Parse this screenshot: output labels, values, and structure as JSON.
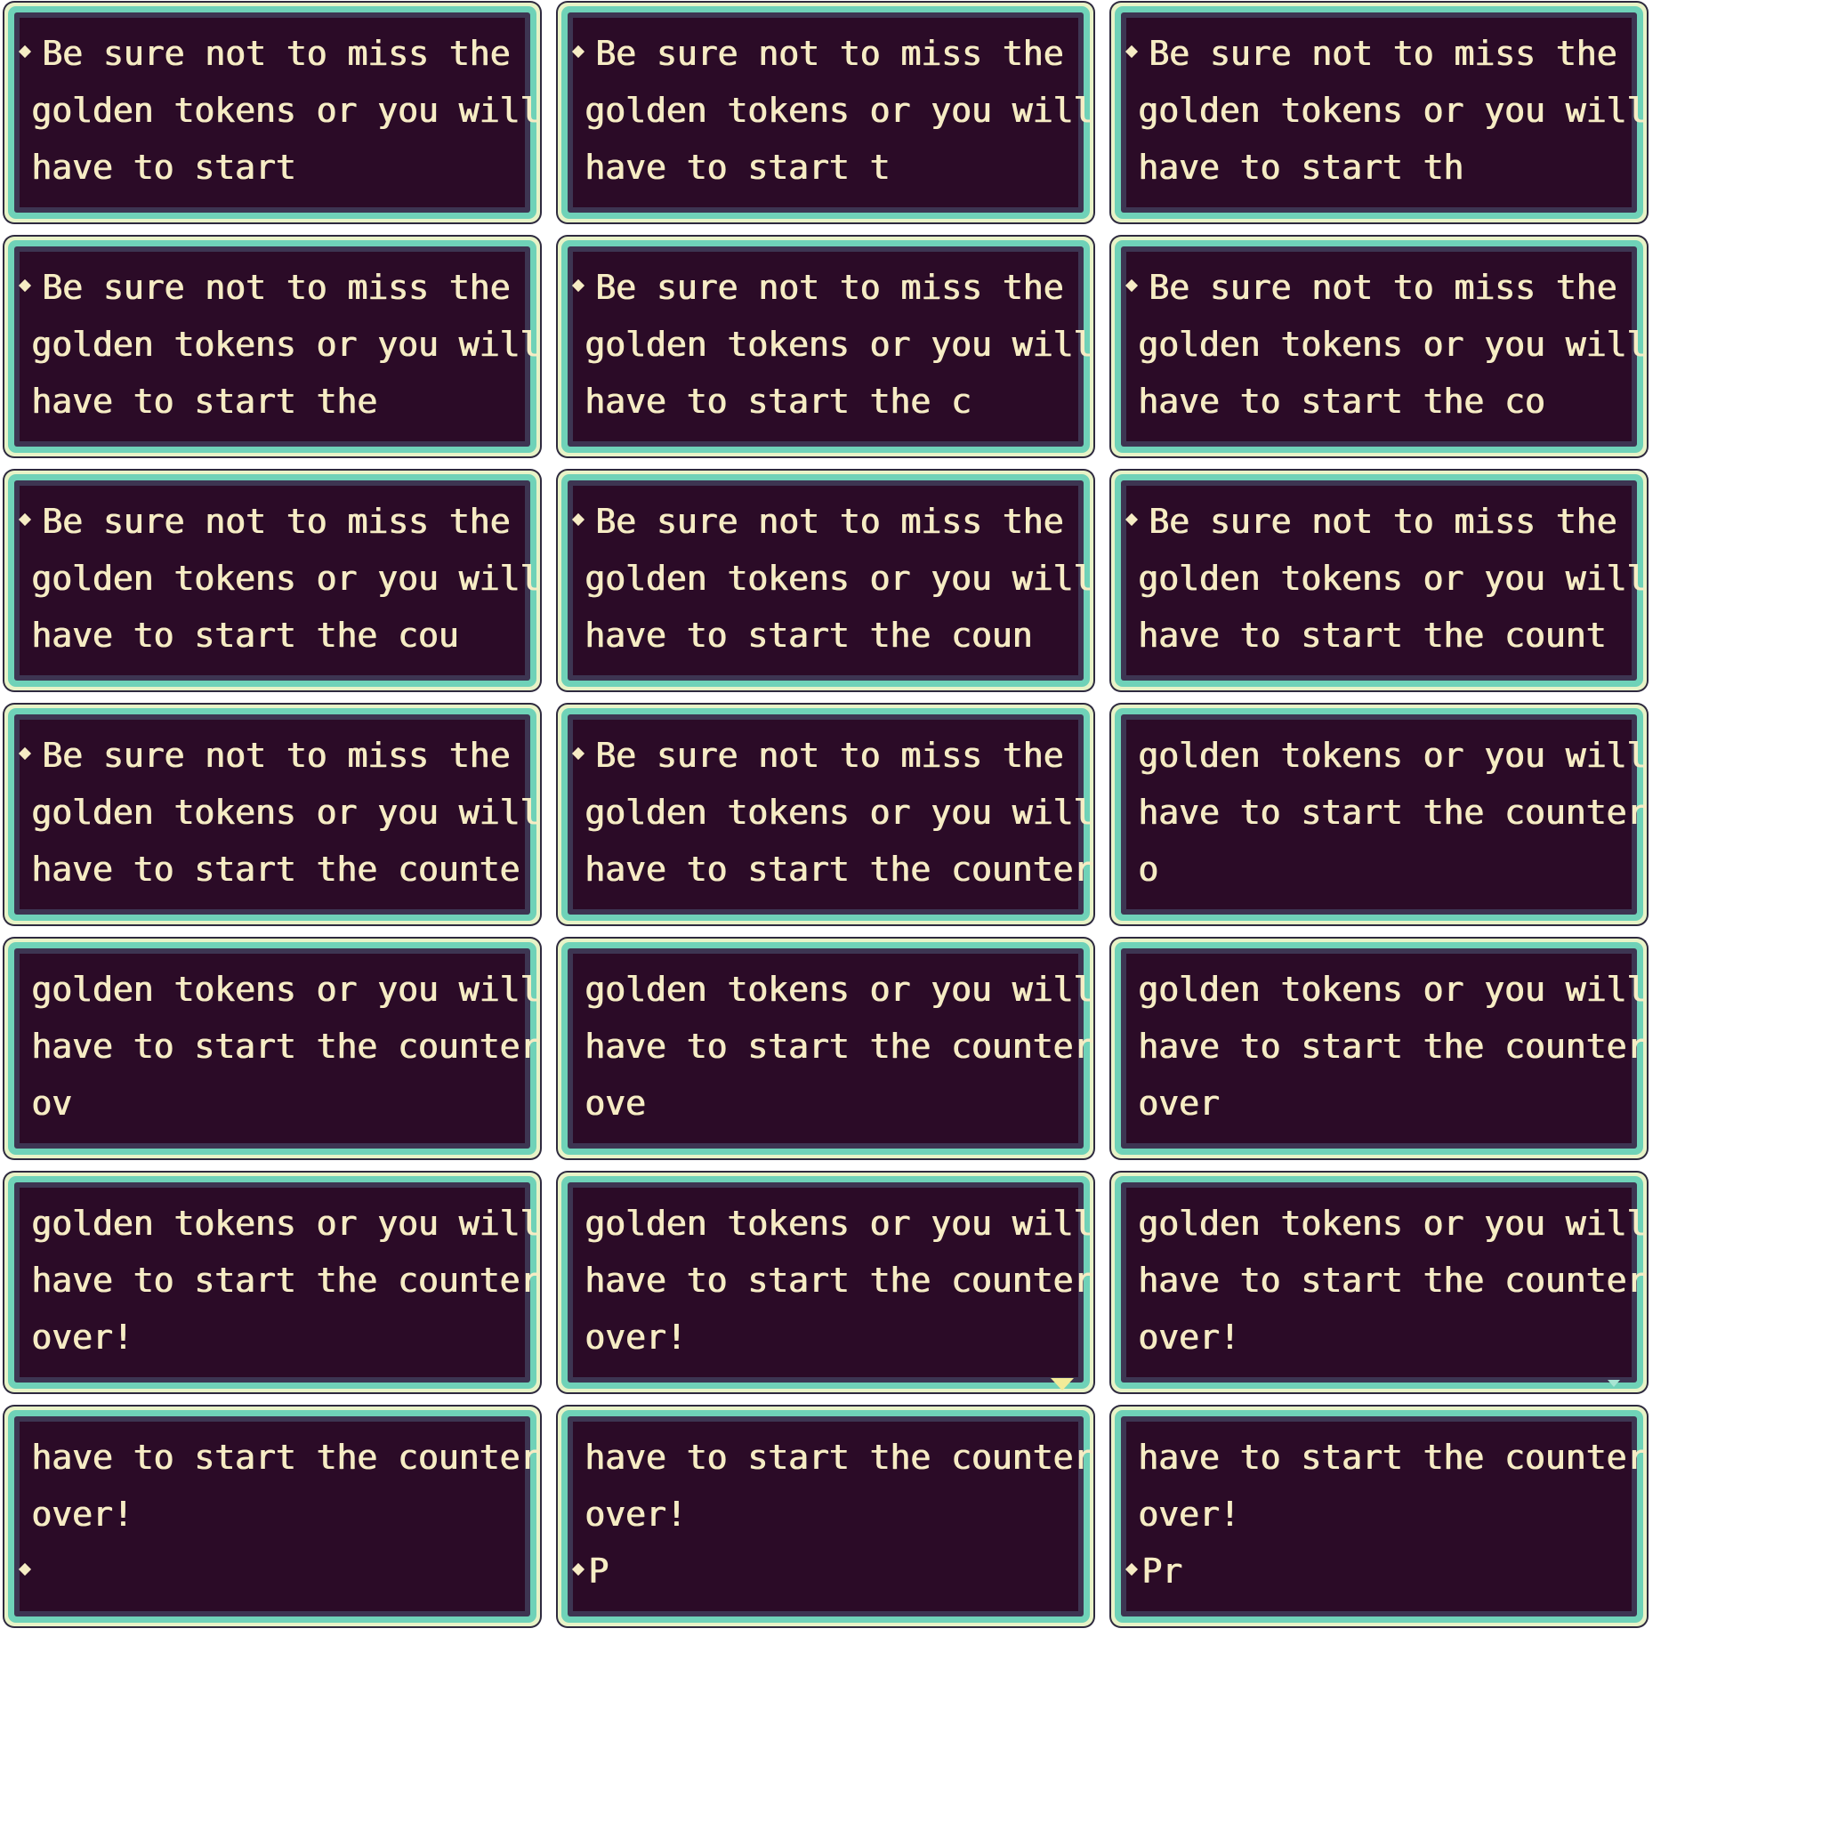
{
  "sheet": {
    "frames": [
      {
        "lines": [
          "Be sure not to miss the",
          "golden tokens or you will",
          "have to start"
        ],
        "bullet_line": 0
      },
      {
        "lines": [
          "Be sure not to miss the",
          "golden tokens or you will",
          "have to start t"
        ],
        "bullet_line": 0
      },
      {
        "lines": [
          "Be sure not to miss the",
          "golden tokens or you will",
          "have to start th"
        ],
        "bullet_line": 0
      },
      {
        "lines": [
          "Be sure not to miss the",
          "golden tokens or you will",
          "have to start the"
        ],
        "bullet_line": 0
      },
      {
        "lines": [
          "Be sure not to miss the",
          "golden tokens or you will",
          "have to start the c"
        ],
        "bullet_line": 0
      },
      {
        "lines": [
          "Be sure not to miss the",
          "golden tokens or you will",
          "have to start the co"
        ],
        "bullet_line": 0
      },
      {
        "lines": [
          "Be sure not to miss the",
          "golden tokens or you will",
          "have to start the cou"
        ],
        "bullet_line": 0
      },
      {
        "lines": [
          "Be sure not to miss the",
          "golden tokens or you will",
          "have to start the coun"
        ],
        "bullet_line": 0
      },
      {
        "lines": [
          "Be sure not to miss the",
          "golden tokens or you will",
          "have to start the count"
        ],
        "bullet_line": 0
      },
      {
        "lines": [
          "Be sure not to miss the",
          "golden tokens or you will",
          "have to start the counte"
        ],
        "bullet_line": 0
      },
      {
        "lines": [
          "Be sure not to miss the",
          "golden tokens or you will",
          "have to start the counter"
        ],
        "bullet_line": 0
      },
      {
        "lines": [
          "golden tokens or you will",
          "have to start the counter",
          "o"
        ],
        "bullet_line": null
      },
      {
        "lines": [
          "golden tokens or you will",
          "have to start the counter",
          "ov"
        ],
        "bullet_line": null
      },
      {
        "lines": [
          "golden tokens or you will",
          "have to start the counter",
          "ove"
        ],
        "bullet_line": null
      },
      {
        "lines": [
          "golden tokens or you will",
          "have to start the counter",
          "over"
        ],
        "bullet_line": null
      },
      {
        "lines": [
          "golden tokens or you will",
          "have to start the counter",
          "over!"
        ],
        "bullet_line": null
      },
      {
        "lines": [
          "golden tokens or you will",
          "have to start the counter",
          "over!"
        ],
        "bullet_line": null,
        "advance_icon": "large"
      },
      {
        "lines": [
          "golden tokens or you will",
          "have to start the counter",
          "over!"
        ],
        "bullet_line": null,
        "advance_icon": "small"
      },
      {
        "lines": [
          "have to start the counter",
          "over!",
          ""
        ],
        "bullet_line": 2
      },
      {
        "lines": [
          "have to start the counter",
          "over!",
          "P"
        ],
        "bullet_line": 2
      },
      {
        "lines": [
          "have to start the counter",
          "over!",
          "Pr"
        ],
        "bullet_line": 2
      }
    ]
  },
  "colors": {
    "panel": "#2b0b27",
    "teal_border": "#6fd2b8",
    "text": "#f6ecc4",
    "advance_icon": "#f3eb98"
  },
  "icons": {
    "bullet": "diamond-bullet-icon",
    "advance": "advance-arrow-icon"
  }
}
